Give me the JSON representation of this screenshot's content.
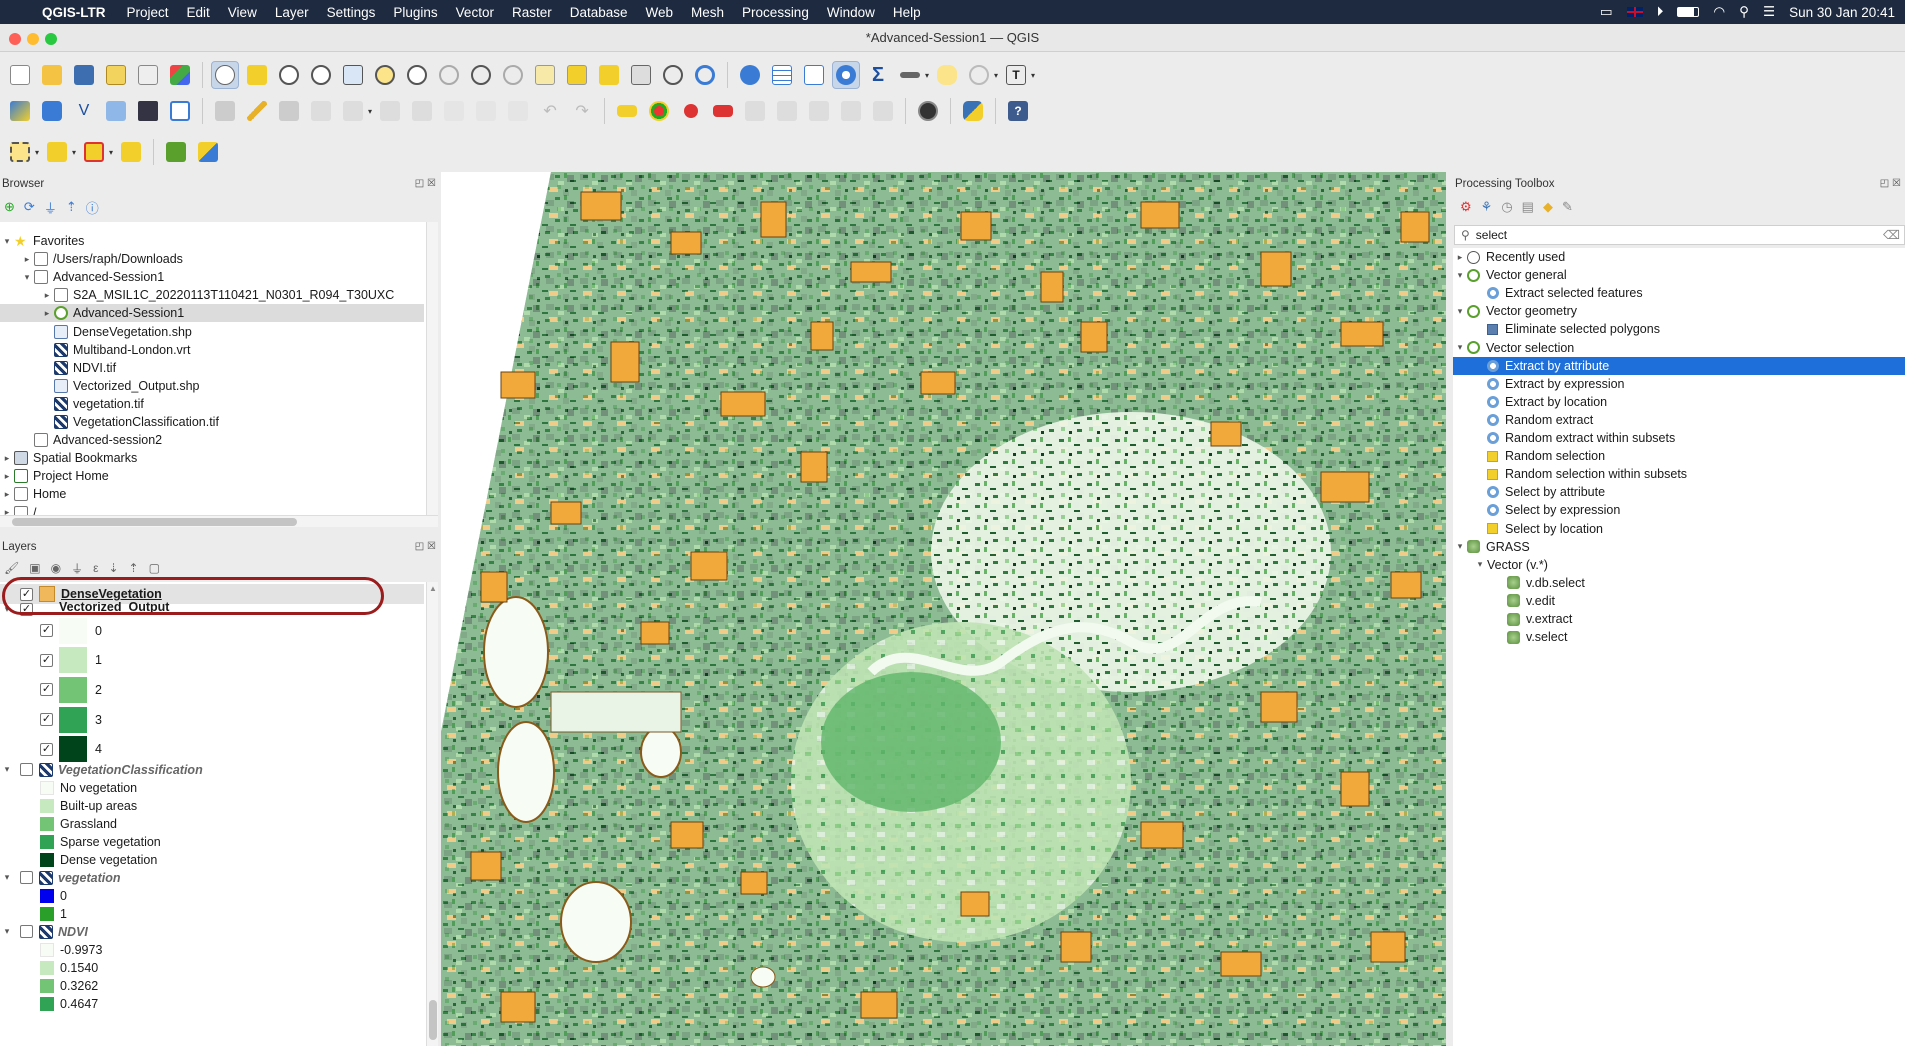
{
  "menubar": {
    "app": "QGIS-LTR",
    "items": [
      "Project",
      "Edit",
      "View",
      "Layer",
      "Settings",
      "Plugins",
      "Vector",
      "Raster",
      "Database",
      "Web",
      "Mesh",
      "Processing",
      "Window",
      "Help"
    ],
    "clock": "Sun 30 Jan  20:41"
  },
  "window": {
    "title": "*Advanced-Session1 — QGIS"
  },
  "browser": {
    "title": "Browser",
    "rows": [
      {
        "label": "Favorites",
        "indent": 0,
        "arrow": "▾",
        "icon": "star"
      },
      {
        "label": "/Users/raph/Downloads",
        "indent": 1,
        "arrow": "▸",
        "icon": "folder"
      },
      {
        "label": "Advanced-Session1",
        "indent": 1,
        "arrow": "▾",
        "icon": "folder"
      },
      {
        "label": "S2A_MSIL1C_20220113T110421_N0301_R094_T30UXC",
        "indent": 2,
        "arrow": "▸",
        "icon": "folder"
      },
      {
        "label": "Advanced-Session1",
        "indent": 2,
        "arrow": "▸",
        "icon": "qgis",
        "selected": true
      },
      {
        "label": "DenseVegetation.shp",
        "indent": 2,
        "arrow": "",
        "icon": "vector"
      },
      {
        "label": "Multiband-London.vrt",
        "indent": 2,
        "arrow": "",
        "icon": "raster"
      },
      {
        "label": "NDVI.tif",
        "indent": 2,
        "arrow": "",
        "icon": "raster"
      },
      {
        "label": "Vectorized_Output.shp",
        "indent": 2,
        "arrow": "",
        "icon": "vector"
      },
      {
        "label": "vegetation.tif",
        "indent": 2,
        "arrow": "",
        "icon": "raster"
      },
      {
        "label": "VegetationClassification.tif",
        "indent": 2,
        "arrow": "",
        "icon": "raster"
      },
      {
        "label": "Advanced-session2",
        "indent": 1,
        "arrow": "",
        "icon": "folder"
      },
      {
        "label": "Spatial Bookmarks",
        "indent": 0,
        "arrow": "▸",
        "icon": "bookmark"
      },
      {
        "label": "Project Home",
        "indent": 0,
        "arrow": "▸",
        "icon": "folder-green"
      },
      {
        "label": "Home",
        "indent": 0,
        "arrow": "▸",
        "icon": "home"
      },
      {
        "label": "/",
        "indent": 0,
        "arrow": "▸",
        "icon": "folder"
      }
    ]
  },
  "layers": {
    "title": "Layers",
    "dense": {
      "label": "DenseVegetation",
      "color": "#f0b85a"
    },
    "vectorized": {
      "label": "Vectorized_Output"
    },
    "classes": [
      {
        "label": "0",
        "color": "#f7fcf5"
      },
      {
        "label": "1",
        "color": "#c7e9c0"
      },
      {
        "label": "2",
        "color": "#74c476"
      },
      {
        "label": "3",
        "color": "#31a354"
      },
      {
        "label": "4",
        "color": "#00441b"
      }
    ],
    "vc": {
      "label": "VegetationClassification",
      "items": [
        {
          "label": "No vegetation",
          "color": "#f7fcf5"
        },
        {
          "label": "Built-up areas",
          "color": "#c7e9c0"
        },
        {
          "label": "Grassland",
          "color": "#74c476"
        },
        {
          "label": "Sparse vegetation",
          "color": "#31a354"
        },
        {
          "label": "Dense vegetation",
          "color": "#00441b"
        }
      ]
    },
    "veg": {
      "label": "vegetation",
      "items": [
        {
          "label": "0",
          "color": "#0000ee"
        },
        {
          "label": "1",
          "color": "#2aa02a"
        }
      ]
    },
    "ndvi": {
      "label": "NDVI",
      "items": [
        {
          "label": "-0.9973",
          "color": "#f7fcf5"
        },
        {
          "label": "0.1540",
          "color": "#c7e9c0"
        },
        {
          "label": "0.3262",
          "color": "#74c476"
        },
        {
          "label": "0.4647",
          "color": "#31a354"
        }
      ]
    }
  },
  "toolbox": {
    "title": "Processing Toolbox",
    "search": "select",
    "rows": [
      {
        "label": "Recently used",
        "indent": 0,
        "arrow": "▸",
        "icon": "clock"
      },
      {
        "label": "Vector general",
        "indent": 0,
        "arrow": "▾",
        "icon": "qgis"
      },
      {
        "label": "Extract selected features",
        "indent": 1,
        "arrow": "",
        "icon": "gear"
      },
      {
        "label": "Vector geometry",
        "indent": 0,
        "arrow": "▾",
        "icon": "qgis"
      },
      {
        "label": "Eliminate selected polygons",
        "indent": 1,
        "arrow": "",
        "icon": "poly"
      },
      {
        "label": "Vector selection",
        "indent": 0,
        "arrow": "▾",
        "icon": "qgis"
      },
      {
        "label": "Extract by attribute",
        "indent": 1,
        "arrow": "",
        "icon": "gear",
        "highlight": true
      },
      {
        "label": "Extract by expression",
        "indent": 1,
        "arrow": "",
        "icon": "gear"
      },
      {
        "label": "Extract by location",
        "indent": 1,
        "arrow": "",
        "icon": "gear"
      },
      {
        "label": "Random extract",
        "indent": 1,
        "arrow": "",
        "icon": "gear"
      },
      {
        "label": "Random extract within subsets",
        "indent": 1,
        "arrow": "",
        "icon": "gear"
      },
      {
        "label": "Random selection",
        "indent": 1,
        "arrow": "",
        "icon": "yellow"
      },
      {
        "label": "Random selection within subsets",
        "indent": 1,
        "arrow": "",
        "icon": "yellow"
      },
      {
        "label": "Select by attribute",
        "indent": 1,
        "arrow": "",
        "icon": "gear"
      },
      {
        "label": "Select by expression",
        "indent": 1,
        "arrow": "",
        "icon": "gear"
      },
      {
        "label": "Select by location",
        "indent": 1,
        "arrow": "",
        "icon": "yellow"
      },
      {
        "label": "GRASS",
        "indent": 0,
        "arrow": "▾",
        "icon": "grass"
      },
      {
        "label": "Vector (v.*)",
        "indent": 1,
        "arrow": "▾",
        "icon": ""
      },
      {
        "label": "v.db.select",
        "indent": 2,
        "arrow": "",
        "icon": "grass"
      },
      {
        "label": "v.edit",
        "indent": 2,
        "arrow": "",
        "icon": "grass"
      },
      {
        "label": "v.extract",
        "indent": 2,
        "arrow": "",
        "icon": "grass"
      },
      {
        "label": "v.select",
        "indent": 2,
        "arrow": "",
        "icon": "grass"
      }
    ]
  },
  "colors": {
    "accent": "#1e6fd9",
    "annotation": "#9b1c1c",
    "patch": "#f2a93b"
  }
}
